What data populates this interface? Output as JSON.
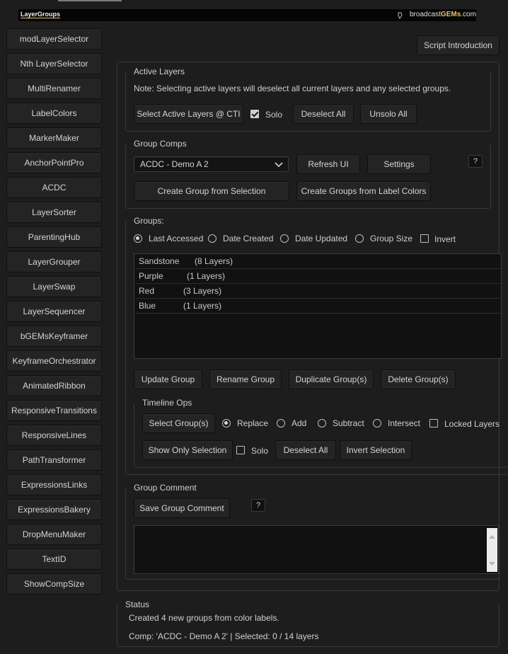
{
  "header": {
    "logo_left": "LayerGroups",
    "logo_right_prefix": "broadcast",
    "logo_right_brand": "GEMs",
    "logo_right_suffix": ".com"
  },
  "sidebar": {
    "items": [
      {
        "label": "modLayerSelector"
      },
      {
        "label": "Nth LayerSelector"
      },
      {
        "label": "MultiRenamer"
      },
      {
        "label": "LabelColors"
      },
      {
        "label": "MarkerMaker"
      },
      {
        "label": "AnchorPointPro"
      },
      {
        "label": "ACDC"
      },
      {
        "label": "LayerSorter"
      },
      {
        "label": "ParentingHub"
      },
      {
        "label": "LayerGrouper"
      },
      {
        "label": "LayerSwap"
      },
      {
        "label": "LayerSequencer"
      },
      {
        "label": "bGEMsKeyframer"
      },
      {
        "label": "KeyframeOrchestrator"
      },
      {
        "label": "AnimatedRibbon"
      },
      {
        "label": "ResponsiveTransitions"
      },
      {
        "label": "ResponsiveLines"
      },
      {
        "label": "PathTransformer"
      },
      {
        "label": "ExpressionsLinks"
      },
      {
        "label": "ExpressionsBakery"
      },
      {
        "label": "DropMenuMaker"
      },
      {
        "label": "TextID"
      },
      {
        "label": "ShowCompSize"
      }
    ]
  },
  "script_intro_label": "Script Introduction",
  "active_layers": {
    "title": "Active Layers",
    "note": "Note: Selecting active layers will deselect all current layers and any selected groups.",
    "select_label": "Select Active Layers @ CTI",
    "solo_label": "Solo",
    "deselect_label": "Deselect All",
    "unsolo_label": "Unsolo All"
  },
  "group_comps": {
    "title": "Group Comps",
    "dropdown_value": "ACDC - Demo A 2",
    "refresh_label": "Refresh UI",
    "settings_label": "Settings",
    "help_label": "?",
    "create_selection_label": "Create Group from Selection",
    "create_colors_label": "Create Groups from Label Colors"
  },
  "groups": {
    "title": "Groups:",
    "sort": {
      "last_accessed": "Last Accessed",
      "date_created": "Date Created",
      "date_updated": "Date Updated",
      "group_size": "Group Size",
      "invert": "Invert"
    },
    "list": [
      {
        "name": "Sandstone",
        "count": "(8 Layers)"
      },
      {
        "name": "Purple",
        "count": "(1 Layers)"
      },
      {
        "name": "Red",
        "count": "(3 Layers)"
      },
      {
        "name": "Blue",
        "count": "(1 Layers)"
      }
    ],
    "update_label": "Update Group",
    "rename_label": "Rename Group",
    "duplicate_label": "Duplicate Group(s)",
    "delete_label": "Delete Group(s)"
  },
  "timeline_ops": {
    "title": "Timeline Ops",
    "select_groups_label": "Select Group(s)",
    "replace": "Replace",
    "add": "Add",
    "subtract": "Subtract",
    "intersect": "Intersect",
    "locked_layers": "Locked Layers",
    "show_only_label": "Show Only Selection",
    "solo_label": "Solo",
    "deselect_label": "Deselect All",
    "invert_label": "Invert Selection"
  },
  "group_comment": {
    "title": "Group Comment",
    "save_label": "Save Group Comment",
    "help_label": "?"
  },
  "status": {
    "title": "Status",
    "line1": "Created 4 new groups from color labels.",
    "line2": "Comp: 'ACDC - Demo A 2' | Selected: 0 / 14 layers"
  },
  "colors": {
    "background": "#1d1d1d",
    "button": "#242424",
    "accent_gold": "#e8c36a"
  }
}
